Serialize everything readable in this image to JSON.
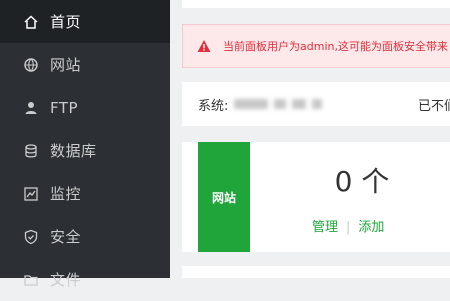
{
  "sidebar": {
    "items": [
      {
        "label": "首页",
        "icon": "home-icon",
        "active": true
      },
      {
        "label": "网站",
        "icon": "globe-icon"
      },
      {
        "label": "FTP",
        "icon": "ftp-user-icon"
      },
      {
        "label": "数据库",
        "icon": "database-icon"
      },
      {
        "label": "监控",
        "icon": "monitor-icon"
      },
      {
        "label": "安全",
        "icon": "shield-icon"
      },
      {
        "label": "文件",
        "icon": "folder-icon"
      }
    ]
  },
  "alert": {
    "text": "当前面板用户为admin,这可能为面板安全带来"
  },
  "system": {
    "label": "系统:",
    "right_text": "已不们"
  },
  "site_stat": {
    "badge": "网站",
    "count": "0 个",
    "manage_label": "管理",
    "separator": "|",
    "add_label": "添加"
  },
  "colors": {
    "sidebar_bg": "#2c2f33",
    "accent_green": "#20a53a",
    "alert_red": "#e0303d"
  }
}
